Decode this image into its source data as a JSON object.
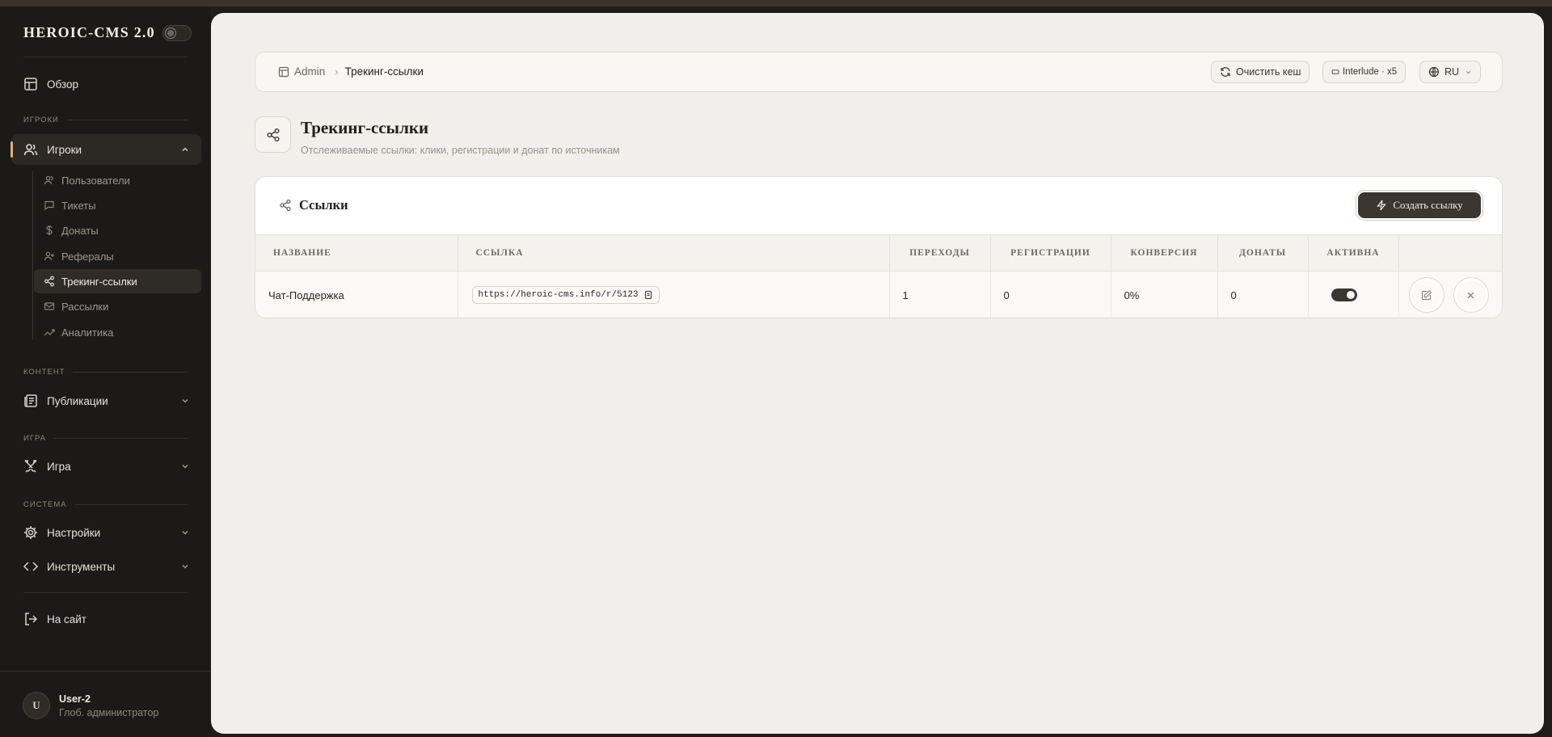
{
  "sidebar": {
    "brand": "HEROIC-CMS 2.0",
    "overview": "Обзор",
    "sections": {
      "players": "ИГРОКИ",
      "content": "КОНТЕНТ",
      "game": "ИГРА",
      "system": "СИСТЕМА"
    },
    "players_group": "Игроки",
    "sub_items": [
      "Пользователи",
      "Тикеты",
      "Донаты",
      "Рефералы",
      "Трекинг-ссылки",
      "Рассылки",
      "Аналитика"
    ],
    "publications": "Публикации",
    "game": "Игра",
    "settings": "Настройки",
    "tools": "Инструменты",
    "to_site": "На сайт",
    "user": {
      "initial": "U",
      "name": "User-2",
      "role": "Глоб. администратор"
    }
  },
  "topbar": {
    "breadcrumb_root": "Admin",
    "breadcrumb_separator": "›",
    "breadcrumb_current": "Трекинг-ссылки",
    "clear_cache": "Очистить кеш",
    "server": "Interlude · x5",
    "language": "RU"
  },
  "page": {
    "title": "Трекинг-ссылки",
    "subtitle": "Отслеживаемые ссылки: клики, регистрации и донат по источникам"
  },
  "card": {
    "title": "Ссылки",
    "create_button": "Создать ссылку",
    "columns": [
      "НАЗВАНИЕ",
      "ССЫЛКА",
      "ПЕРЕХОДЫ",
      "РЕГИСТРАЦИИ",
      "КОНВЕРСИЯ",
      "ДОНАТЫ",
      "АКТИВНА",
      ""
    ],
    "rows": [
      {
        "name": "Чат-Поддержка",
        "link": "https://heroic-cms.info/r/5123",
        "clicks": "1",
        "registrations": "0",
        "conversion": "0%",
        "donations": "0",
        "active": true
      }
    ]
  },
  "colors": {
    "sidebar_bg": "#1c1a18",
    "main_bg": "#f1efeb",
    "accent": "#d9b27a",
    "button_dark": "#3b3630"
  }
}
